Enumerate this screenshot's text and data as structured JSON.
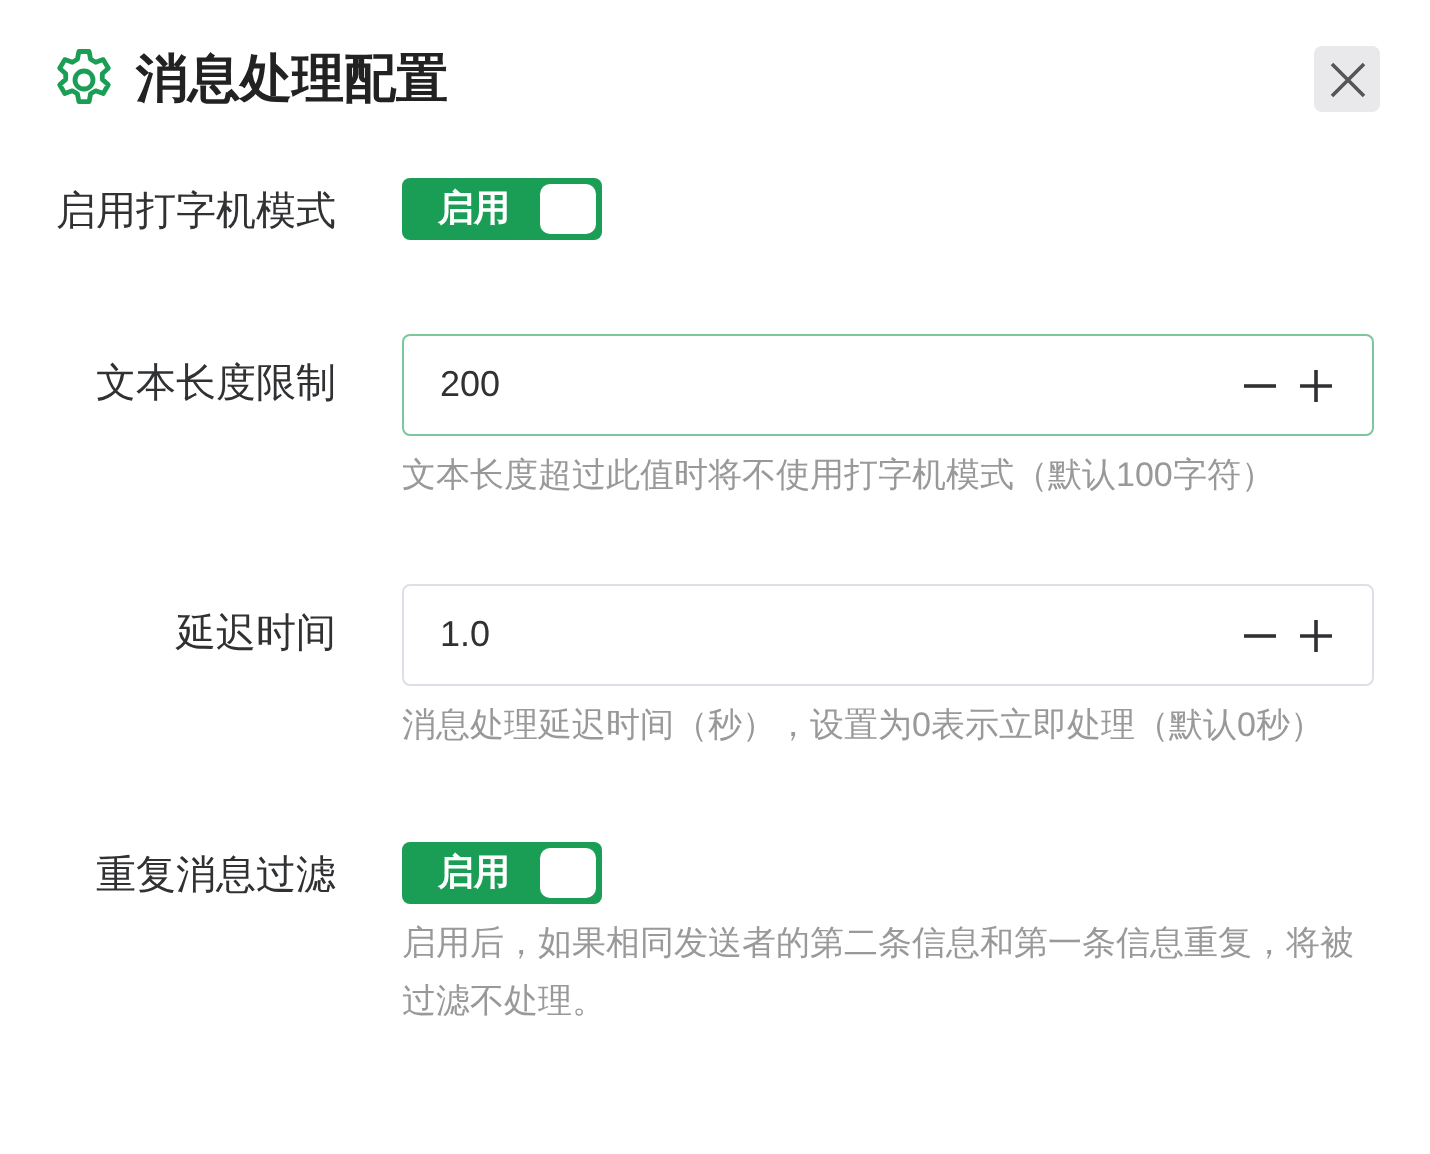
{
  "dialog": {
    "title": "消息处理配置"
  },
  "fields": [
    {
      "kind": "switch",
      "label": "启用打字机模式",
      "on": true,
      "switch_text": "启用"
    },
    {
      "kind": "number",
      "label": "文本长度限制",
      "value": "200",
      "focused": true,
      "hint": "文本长度超过此值时将不使用打字机模式（默认100字符）"
    },
    {
      "kind": "number",
      "label": "延迟时间",
      "value": "1.0",
      "focused": false,
      "hint": "消息处理延迟时间（秒），设置为0表示立即处理（默认0秒）"
    },
    {
      "kind": "switch",
      "label": "重复消息过滤",
      "on": true,
      "switch_text": "启用",
      "hint": "启用后，如果相同发送者的第二条信息和第一条信息重复，将被过滤不处理。"
    }
  ]
}
